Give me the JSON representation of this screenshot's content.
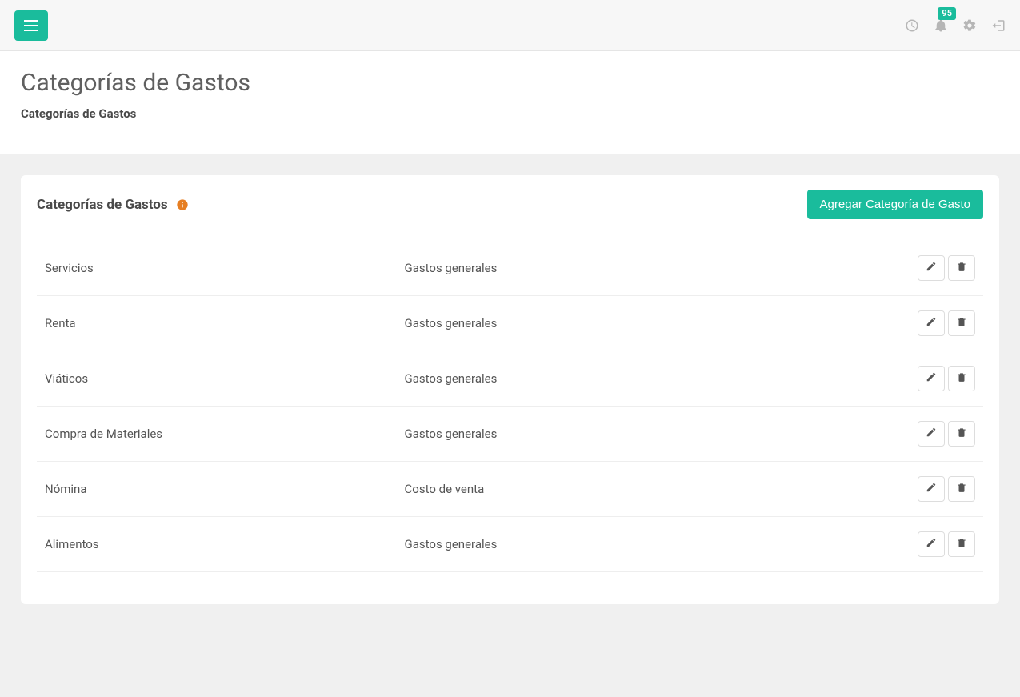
{
  "topbar": {
    "notification_count": "95"
  },
  "header": {
    "title": "Categorías de Gastos",
    "breadcrumb": "Categorías de Gastos"
  },
  "panel": {
    "title": "Categorías de Gastos",
    "add_button": "Agregar Categoría de Gasto"
  },
  "rows": [
    {
      "name": "Servicios",
      "type": "Gastos generales"
    },
    {
      "name": "Renta",
      "type": "Gastos generales"
    },
    {
      "name": "Viáticos",
      "type": "Gastos generales"
    },
    {
      "name": "Compra de Materiales",
      "type": "Gastos generales"
    },
    {
      "name": "Nómina",
      "type": "Costo de venta"
    },
    {
      "name": "Alimentos",
      "type": "Gastos generales"
    }
  ]
}
